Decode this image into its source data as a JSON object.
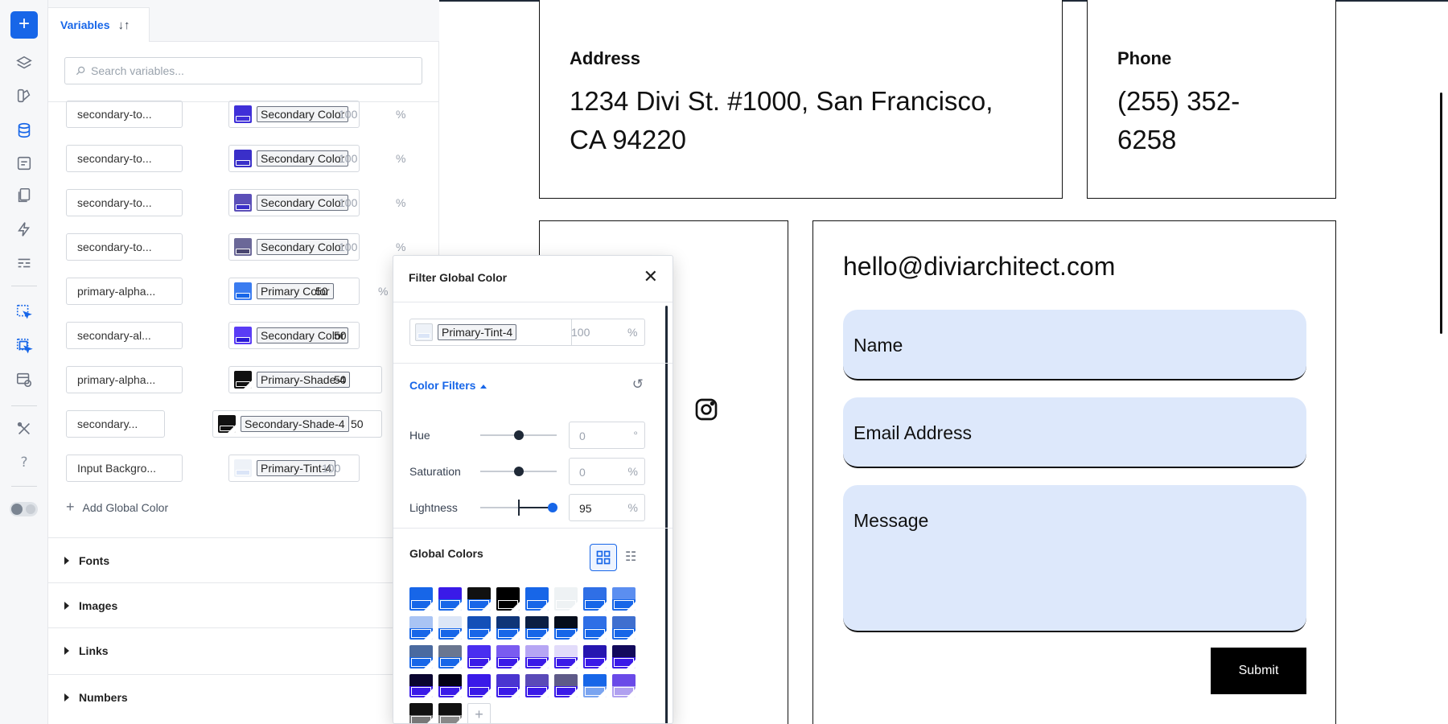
{
  "rail": {
    "add_label": "+",
    "icons": [
      "layers-icon",
      "palette-icon",
      "database-icon",
      "forms-icon",
      "pages-icon",
      "lightning-icon",
      "layout-icon",
      "select-icon",
      "multi-select-icon",
      "preview-icon",
      "tools-icon",
      "help-icon",
      "theme-toggle-icon"
    ],
    "help_label": "?"
  },
  "panel": {
    "tab_label": "Variables",
    "tab_sort_label": "↓↑",
    "search_placeholder": "Search variables...",
    "add_global_label": "Add Global Color",
    "add_global_plus": "+",
    "sections": [
      "Fonts",
      "Images",
      "Links",
      "Numbers"
    ],
    "variables": [
      {
        "name": "secondary-to...",
        "color": "Secondary Color",
        "opacity": "100",
        "unit": "%",
        "swatch_top": "#3f2fd8",
        "swatch_bar": "#3f2fd8",
        "dim": true
      },
      {
        "name": "secondary-to...",
        "color": "Secondary Color",
        "opacity": "100",
        "unit": "%",
        "swatch_top": "#3a2fc9",
        "swatch_bar": "#3a2fc9",
        "dim": true
      },
      {
        "name": "secondary-to...",
        "color": "Secondary Color",
        "opacity": "100",
        "unit": "%",
        "swatch_top": "#5b4fb8",
        "swatch_bar": "#3a2fc9",
        "dim": true
      },
      {
        "name": "secondary-to...",
        "color": "Secondary Color",
        "opacity": "100",
        "unit": "%",
        "swatch_top": "#6b6898",
        "swatch_bar": "#4a4670",
        "dim": true
      },
      {
        "name": "primary-alpha...",
        "color": "Primary Color",
        "opacity": "50",
        "unit": "%",
        "swatch_top": "#3b7cf0",
        "swatch_bar": "#1766e8",
        "dim": false
      },
      {
        "name": "secondary-al...",
        "color": "Secondary Color",
        "opacity": "50",
        "unit": "",
        "swatch_top": "#5a3cf5",
        "swatch_bar": "#2b1ad6",
        "dim": false
      },
      {
        "name": "primary-alpha...",
        "color": "Primary-Shade-4",
        "opacity": "50",
        "unit": "",
        "swatch_top": "#111",
        "swatch_bar": "#111",
        "dim": false
      },
      {
        "name": "secondary...",
        "color": "Secondary-Shade-4",
        "opacity": "50",
        "unit": "",
        "swatch_top": "#111",
        "swatch_bar": "#111",
        "dim": false
      },
      {
        "name": "Input Backgro...",
        "color": "Primary-Tint-4",
        "opacity": "100",
        "unit": "",
        "swatch_top": "#eef2f8",
        "swatch_bar": "#dbe5f7",
        "dim": true
      }
    ]
  },
  "popup": {
    "title": "Filter Global Color",
    "close_label": "✕",
    "selected_color": "Primary-Tint-4",
    "selected_opacity": "100",
    "selected_unit": "%",
    "filters_title": "Color Filters",
    "reset_label": "↺",
    "filters": [
      {
        "label": "Hue",
        "value": "0",
        "unit": "°",
        "level": 0.5
      },
      {
        "label": "Saturation",
        "value": "0",
        "unit": "%",
        "level": 0.5
      },
      {
        "label": "Lightness",
        "value": "95",
        "unit": "%",
        "level": 0.95
      }
    ],
    "global_colors_title": "Global Colors",
    "list_view_label": "☷",
    "add_label": "+",
    "swatches": [
      [
        "#1766e8",
        "#1766e8"
      ],
      [
        "#3a1ae8",
        "#1766e8"
      ],
      [
        "#111",
        "#1766e8"
      ],
      [
        "#000",
        "#000"
      ],
      [
        "#1766e8",
        "#1766e8"
      ],
      [
        "#eef2f4",
        "#eef2f4"
      ],
      [
        "#2f6fe6",
        "#1766e8"
      ],
      [
        "#5b8ef0",
        "#1766e8"
      ],
      [
        "#a9c4f4",
        "#1766e8"
      ],
      [
        "#dce6f7",
        "#1766e8"
      ],
      [
        "#1450b8",
        "#1766e8"
      ],
      [
        "#0f3578",
        "#1766e8"
      ],
      [
        "#0b1f44",
        "#1766e8"
      ],
      [
        "#050d1c",
        "#1766e8"
      ],
      [
        "#2f6fe6",
        "#1766e8"
      ],
      [
        "#3f6fcf",
        "#1766e8"
      ],
      [
        "#4a6aa0",
        "#1766e8"
      ],
      [
        "#6a7690",
        "#1766e8"
      ],
      [
        "#4a2ef0",
        "#3a1ae8"
      ],
      [
        "#7a5cf0",
        "#3a1ae8"
      ],
      [
        "#b6a6f4",
        "#3a1ae8"
      ],
      [
        "#e2dcfa",
        "#3a1ae8"
      ],
      [
        "#2616b0",
        "#3a1ae8"
      ],
      [
        "#120a5c",
        "#3a1ae8"
      ],
      [
        "#0a0530",
        "#3a1ae8"
      ],
      [
        "#040214",
        "#3a1ae8"
      ],
      [
        "#3a1ae8",
        "#3a1ae8"
      ],
      [
        "#4a35d0",
        "#3a1ae8"
      ],
      [
        "#5a4ab8",
        "#3a1ae8"
      ],
      [
        "#5e5a88",
        "#3a1ae8"
      ],
      [
        "#1766e8",
        "#7aa4f0"
      ],
      [
        "#6a4ae8",
        "#b0a0f0"
      ],
      [
        "#111",
        "#777"
      ],
      [
        "#111",
        "#888"
      ]
    ]
  },
  "page": {
    "address_label": "Address",
    "address_line1": "1234 Divi St. #1000, San Francisco,",
    "address_line2": "CA 94220",
    "phone_label": "Phone",
    "phone_line1": "(255) 352-",
    "phone_line2": "6258",
    "email": "hello@diviarchitect.com",
    "name_placeholder": "Name",
    "email_placeholder": "Email Address",
    "message_placeholder": "Message",
    "submit_label": "Submit"
  },
  "colors": {
    "accent": "#1766e8",
    "field_bg": "#dde8fb"
  }
}
